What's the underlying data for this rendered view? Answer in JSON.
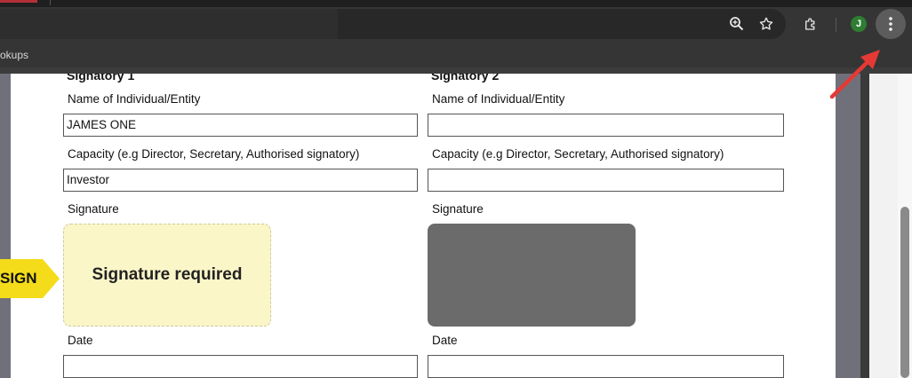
{
  "browser": {
    "bookmarks_item": "okups",
    "profile_initial": "J",
    "icons": [
      "zoom-icon",
      "star-icon",
      "extensions-icon",
      "more-vert-icon"
    ]
  },
  "document": {
    "col1": {
      "heading": "Signatory 1",
      "name_label": "Name of Individual/Entity",
      "name_value": "JAMES ONE",
      "capacity_label": "Capacity (e.g Director, Secretary, Authorised signatory)",
      "capacity_value": "Investor",
      "signature_label": "Signature",
      "signature_text": "Signature required",
      "date_label": "Date",
      "date_value": ""
    },
    "col2": {
      "heading": "Signatory 2",
      "name_label": "Name of Individual/Entity",
      "name_value": "",
      "capacity_label": "Capacity (e.g Director, Secretary, Authorised signatory)",
      "capacity_value": "",
      "signature_label": "Signature",
      "date_label": "Date",
      "date_value": ""
    },
    "sign_tag": "SIGN"
  },
  "colors": {
    "annotation_arrow": "#e53935",
    "sign_tag": "#f4dc1a",
    "signature_required_bg": "#fbf6c8",
    "signature_disabled_bg": "#6b6b6b"
  }
}
